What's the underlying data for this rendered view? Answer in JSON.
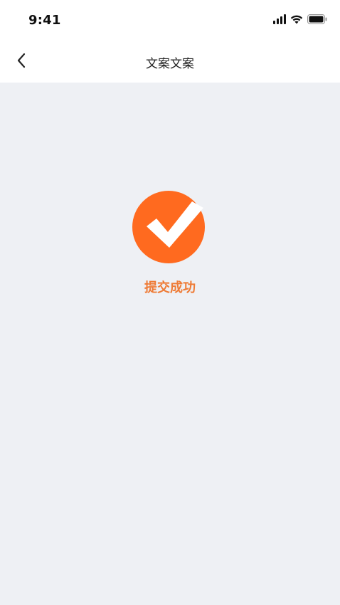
{
  "status_bar": {
    "time": "9:41",
    "icons": [
      "signal-icon",
      "wifi-icon",
      "battery-icon"
    ]
  },
  "nav": {
    "title": "文案文案",
    "back_icon": "chevron-left-icon"
  },
  "result": {
    "icon": "check-circle-icon",
    "message": "提交成功",
    "accent_color": "#ff6a1f",
    "text_color": "#ee7b36"
  },
  "colors": {
    "page_background": "#eef0f4",
    "bar_background": "#ffffff"
  }
}
